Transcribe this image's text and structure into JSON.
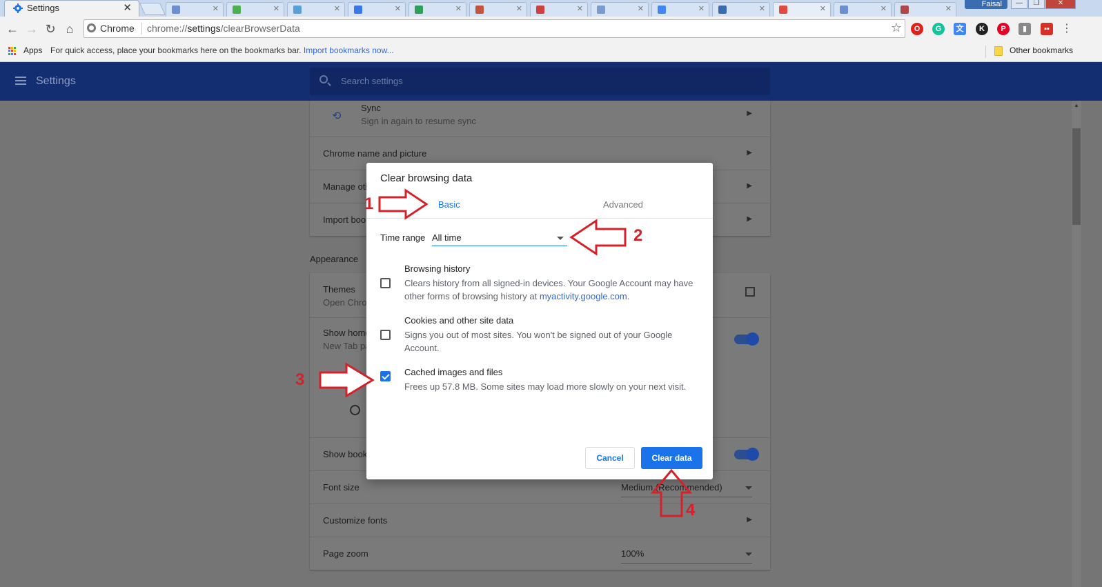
{
  "browser": {
    "tab_title": "Settings",
    "tab_close": "✕",
    "profile_name": "Faisal",
    "omnibox_chip": "Chrome",
    "url_prefix": "chrome://",
    "url_host": "settings",
    "url_path": "/clearBrowserData"
  },
  "bookmarks_bar": {
    "apps_label": "Apps",
    "hint_text": "For quick access, place your bookmarks here on the bookmarks bar.",
    "import_link": "Import bookmarks now...",
    "other_bookmarks": "Other bookmarks"
  },
  "settings": {
    "title": "Settings",
    "search_placeholder": "Search settings",
    "sync_label": "Sync",
    "sync_sub": "Sign in again to resume sync",
    "chrome_name_picture": "Chrome name and picture",
    "manage_other": "Manage oth",
    "import_bookmarks": "Import boo",
    "appearance_heading": "Appearance",
    "themes_label": "Themes",
    "themes_sub": "Open Chron",
    "show_home": "Show home",
    "show_home_sub": "New Tab pa",
    "show_bookmarks": "Show book",
    "font_size_label": "Font size",
    "font_size_value": "Medium (Recommended)",
    "customize_fonts": "Customize fonts",
    "page_zoom_label": "Page zoom",
    "page_zoom_value": "100%"
  },
  "dialog": {
    "title": "Clear browsing data",
    "tab_basic": "Basic",
    "tab_advanced": "Advanced",
    "time_range_label": "Time range",
    "time_range_value": "All time",
    "options": [
      {
        "title": "Browsing history",
        "desc_before_link": "Clears history from all signed-in devices. Your Google Account may have other forms of browsing history at ",
        "link": "myactivity.google.com",
        "desc_after_link": ".",
        "checked": false
      },
      {
        "title": "Cookies and other site data",
        "desc": "Signs you out of most sites. You won't be signed out of your Google Account.",
        "checked": false
      },
      {
        "title": "Cached images and files",
        "desc": "Frees up 57.8 MB. Some sites may load more slowly on your next visit.",
        "checked": true
      }
    ],
    "cancel_label": "Cancel",
    "clear_label": "Clear data"
  },
  "annotations": {
    "n1": "1",
    "n2": "2",
    "n3": "3",
    "n4": "4",
    "arrow_color": "#d3222a"
  },
  "colors": {
    "header_bg": "#142e72",
    "accent": "#1a73e8",
    "overlay_page": "#757575"
  }
}
